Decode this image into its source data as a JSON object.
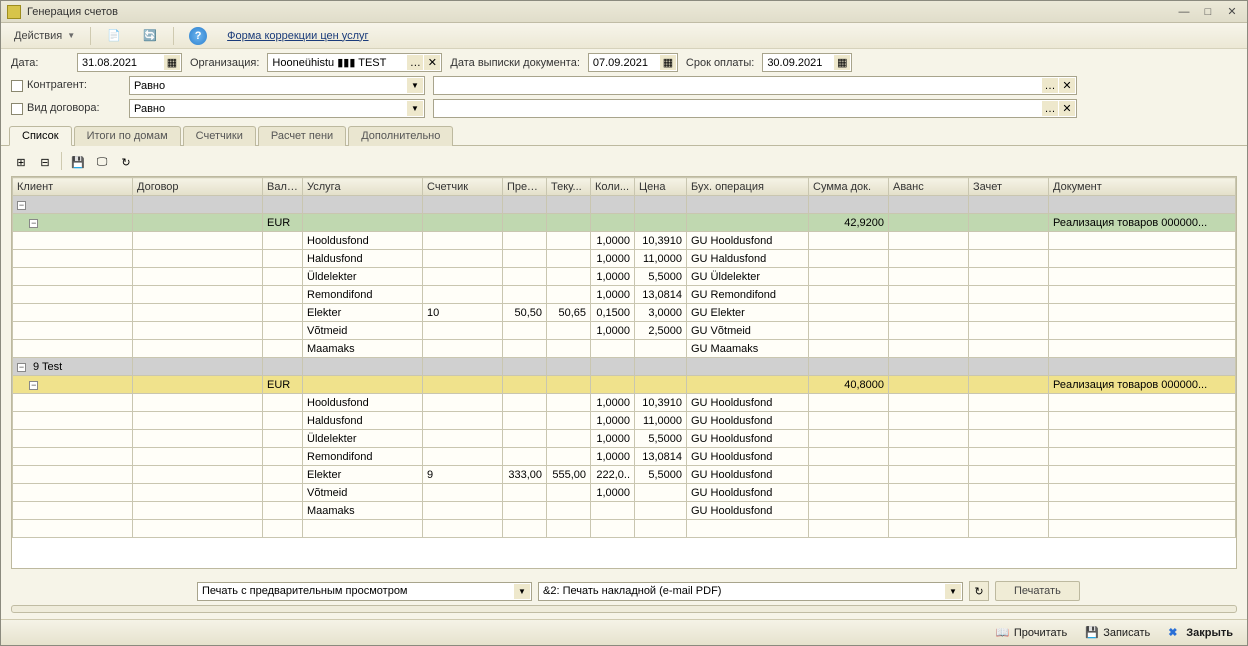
{
  "window": {
    "title": "Генерация счетов"
  },
  "toolbar": {
    "actions": "Действия",
    "link": "Форма коррекции цен услуг"
  },
  "params": {
    "date_label": "Дата:",
    "date_value": "31.08.2021",
    "org_label": "Организация:",
    "org_value": "Hooneühistu ▮▮▮ TEST",
    "docdate_label": "Дата выписки документа:",
    "docdate_value": "07.09.2021",
    "due_label": "Срок оплаты:",
    "due_value": "30.09.2021",
    "counterparty_label": "Контрагент:",
    "contract_type_label": "Вид договора:",
    "equals": "Равно"
  },
  "tabs": [
    "Список",
    "Итоги по домам",
    "Счетчики",
    "Расчет пени",
    "Дополнительно"
  ],
  "columns": {
    "client": "Клиент",
    "contract": "Договор",
    "currency": "Валю...",
    "service": "Услуга",
    "meter": "Счетчик",
    "prev": "Пред...",
    "curr": "Теку...",
    "qty": "Коли...",
    "price": "Цена",
    "op": "Бух. операция",
    "sum": "Сумма док.",
    "advance": "Аванс",
    "offset": "Зачет",
    "doc": "Документ"
  },
  "groups": [
    {
      "client_header": "",
      "currency": "EUR",
      "sum": "42,9200",
      "doc": "Реализация товаров 000000...",
      "row_color": "green",
      "details": [
        {
          "service": "Hooldusfond",
          "meter": "",
          "prev": "",
          "curr": "",
          "qty": "1,0000",
          "price": "10,3910",
          "op": "GU Hooldusfond"
        },
        {
          "service": "Haldusfond",
          "meter": "",
          "prev": "",
          "curr": "",
          "qty": "1,0000",
          "price": "11,0000",
          "op": "GU Haldusfond"
        },
        {
          "service": "Üldelekter",
          "meter": "",
          "prev": "",
          "curr": "",
          "qty": "1,0000",
          "price": "5,5000",
          "op": "GU Üldelekter"
        },
        {
          "service": "Remondifond",
          "meter": "",
          "prev": "",
          "curr": "",
          "qty": "1,0000",
          "price": "13,0814",
          "op": "GU Remondifond"
        },
        {
          "service": "Elekter",
          "meter": "10",
          "prev": "50,50",
          "curr": "50,65",
          "qty": "0,1500",
          "price": "3,0000",
          "op": "GU Elekter"
        },
        {
          "service": "Võtmeid",
          "meter": "",
          "prev": "",
          "curr": "",
          "qty": "1,0000",
          "price": "2,5000",
          "op": "GU Võtmeid"
        },
        {
          "service": "Maamaks",
          "meter": "",
          "prev": "",
          "curr": "",
          "qty": "",
          "price": "",
          "op": "GU Maamaks"
        }
      ]
    },
    {
      "client_header": "9 Test",
      "currency": "EUR",
      "sum": "40,8000",
      "doc": "Реализация товаров 000000...",
      "row_color": "yellow",
      "details": [
        {
          "service": "Hooldusfond",
          "meter": "",
          "prev": "",
          "curr": "",
          "qty": "1,0000",
          "price": "10,3910",
          "op": "GU Hooldusfond"
        },
        {
          "service": "Haldusfond",
          "meter": "",
          "prev": "",
          "curr": "",
          "qty": "1,0000",
          "price": "11,0000",
          "op": "GU Hooldusfond"
        },
        {
          "service": "Üldelekter",
          "meter": "",
          "prev": "",
          "curr": "",
          "qty": "1,0000",
          "price": "5,5000",
          "op": "GU Hooldusfond"
        },
        {
          "service": "Remondifond",
          "meter": "",
          "prev": "",
          "curr": "",
          "qty": "1,0000",
          "price": "13,0814",
          "op": "GU Hooldusfond"
        },
        {
          "service": "Elekter",
          "meter": "9",
          "prev": "333,00",
          "curr": "555,00",
          "qty": "222,0..",
          "price": "5,5000",
          "op": "GU Hooldusfond"
        },
        {
          "service": "Võtmeid",
          "meter": "",
          "prev": "",
          "curr": "",
          "qty": "1,0000",
          "price": "",
          "op": "GU Hooldusfond"
        },
        {
          "service": "Maamaks",
          "meter": "",
          "prev": "",
          "curr": "",
          "qty": "",
          "price": "",
          "op": "GU Hooldusfond"
        }
      ]
    }
  ],
  "print": {
    "left_combo": "Печать с предварительным просмотром",
    "right_combo": "&2: Печать накладной (e-mail PDF)",
    "button": "Печатать"
  },
  "status": {
    "read": "Прочитать",
    "write": "Записать",
    "close": "Закрыть"
  }
}
